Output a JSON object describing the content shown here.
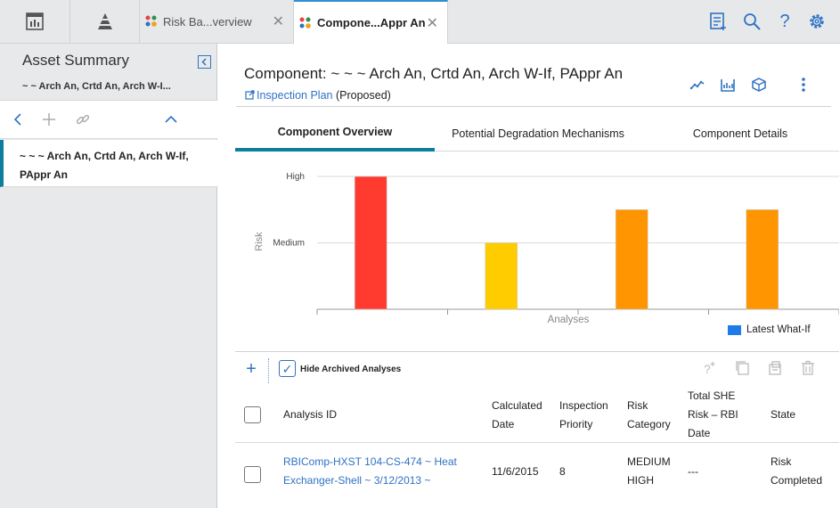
{
  "topbar": {
    "tabs": [
      {
        "label": "Risk Ba...verview",
        "close": "✕"
      },
      {
        "label": "Compone...Appr An",
        "close": "✕"
      }
    ],
    "icons": [
      "dashboard-icon",
      "pyramid-icon",
      "checklist-icon",
      "search-icon",
      "help-icon",
      "gear-icon"
    ],
    "help_glyph": "?"
  },
  "left": {
    "title": "Asset Summary",
    "subtitle": "~ ~ Arch An, Crtd An, Arch W-I...",
    "item_line1": "~ ~ ~ Arch An, Crtd An, Arch W-If,",
    "item_line2": "PAppr An"
  },
  "main": {
    "title": "Component: ~ ~ ~ Arch An, Crtd An, Arch W-If, PAppr An",
    "inspection_link": "Inspection Plan",
    "inspection_state": "(Proposed)",
    "tabs": [
      {
        "label": "Component Overview",
        "active": true
      },
      {
        "label": "Potential Degradation Mechanisms",
        "active": false
      },
      {
        "label": "Component Details",
        "active": false
      }
    ]
  },
  "chart_data": {
    "type": "bar",
    "categories": [
      "",
      "",
      "",
      ""
    ],
    "values": [
      3,
      2,
      2.5,
      2.5
    ],
    "colors": [
      "#ff3b30",
      "#ffcc00",
      "#ff9500",
      "#ff9500"
    ],
    "y_tick_labels": [
      "Medium",
      "High"
    ],
    "y_tick_values": [
      2,
      3
    ],
    "ylim": [
      1,
      3
    ],
    "xlabel": "Analyses",
    "ylabel": "Risk",
    "legend": {
      "label": "Latest What-If",
      "color": "#1e7be8",
      "placement": "bottom-right"
    },
    "grid": true
  },
  "grid_toolbar": {
    "hide_archived_label": "Hide Archived Analyses",
    "hide_archived_checked": true,
    "check_glyph": "✓",
    "add_glyph": "+"
  },
  "table": {
    "headers": {
      "analysis_id": "Analysis ID",
      "calc_date_1": "Calculated",
      "calc_date_2": "Date",
      "insp_pri_1": "Inspection",
      "insp_pri_2": "Priority",
      "risk_cat_1": "Risk",
      "risk_cat_2": "Category",
      "she_1": "Total SHE",
      "she_2": "Risk – RBI",
      "she_3": "Date",
      "state": "State"
    },
    "rows": [
      {
        "id_line1": "RBIComp-HXST 104-CS-474 ~ Heat",
        "id_line2": "Exchanger-Shell ~ 3/12/2013 ~",
        "calc_date": "11/6/2015",
        "priority": "8",
        "risk_line1": "MEDIUM",
        "risk_line2": "HIGH",
        "she_date": "---",
        "state_line1": "Risk",
        "state_line2": "Completed"
      }
    ]
  }
}
